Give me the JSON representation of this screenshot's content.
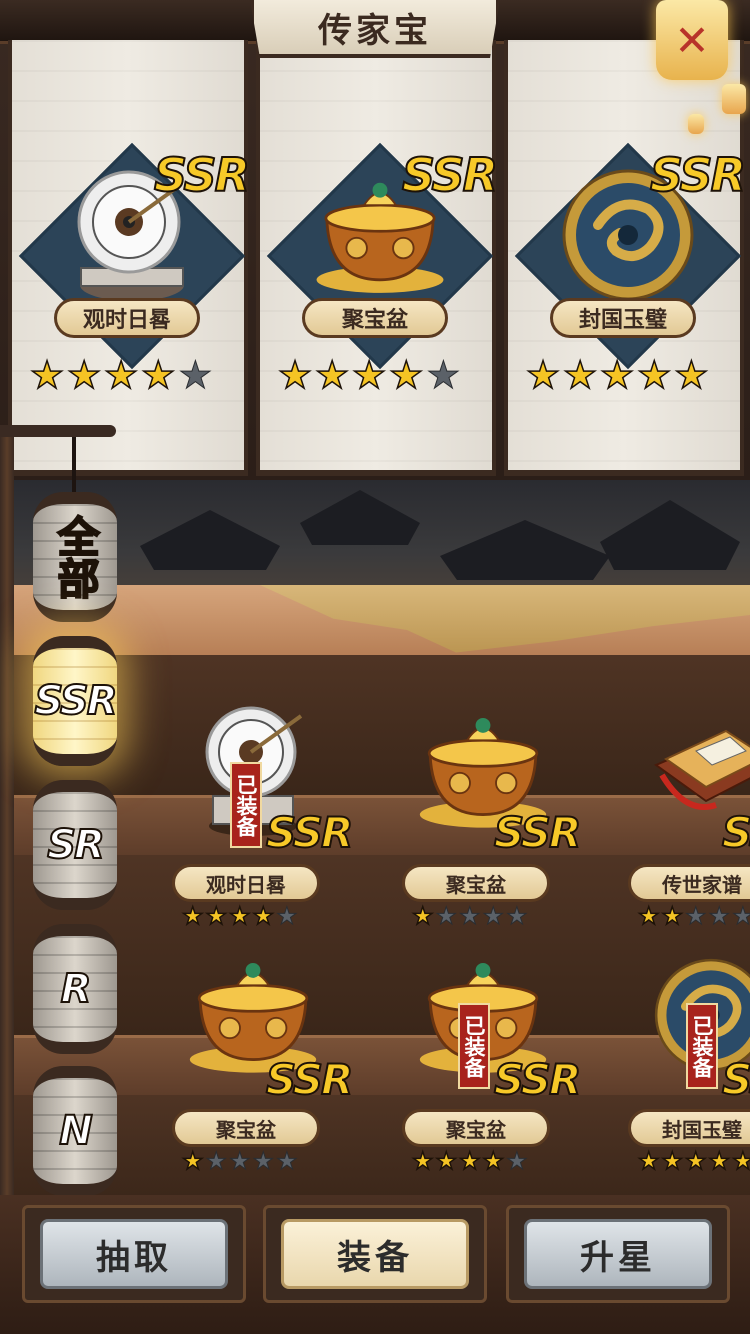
{
  "header": {
    "title": "传家宝",
    "close_icon": "close-lantern-icon"
  },
  "equipped": [
    {
      "name": "观时日晷",
      "rarity": "SSR",
      "stars_filled": 4,
      "stars_total": 5,
      "icon": "sundial-icon"
    },
    {
      "name": "聚宝盆",
      "rarity": "SSR",
      "stars_filled": 4,
      "stars_total": 5,
      "icon": "treasure-bowl-icon"
    },
    {
      "name": "封国玉璧",
      "rarity": "SSR",
      "stars_filled": 5,
      "stars_total": 5,
      "icon": "jade-disc-icon"
    }
  ],
  "tabs": [
    {
      "label": "全部",
      "active": false
    },
    {
      "label": "SSR",
      "active": true
    },
    {
      "label": "SR",
      "active": false
    },
    {
      "label": "R",
      "active": false
    },
    {
      "label": "N",
      "active": false
    }
  ],
  "inventory": [
    {
      "name": "观时日晷",
      "rarity": "SSR",
      "stars_filled": 4,
      "stars_total": 5,
      "equipped": true,
      "equipped_label": "已装备",
      "icon": "sundial-icon"
    },
    {
      "name": "聚宝盆",
      "rarity": "SSR",
      "stars_filled": 1,
      "stars_total": 5,
      "equipped": false,
      "equipped_label": "",
      "icon": "treasure-bowl-icon"
    },
    {
      "name": "传世家谱",
      "rarity": "SSR",
      "stars_filled": 2,
      "stars_total": 5,
      "equipped": false,
      "equipped_label": "",
      "icon": "family-book-icon"
    },
    {
      "name": "聚宝盆",
      "rarity": "SSR",
      "stars_filled": 1,
      "stars_total": 5,
      "equipped": false,
      "equipped_label": "",
      "icon": "treasure-bowl-icon"
    },
    {
      "name": "聚宝盆",
      "rarity": "SSR",
      "stars_filled": 4,
      "stars_total": 5,
      "equipped": true,
      "equipped_label": "已装备",
      "icon": "treasure-bowl-icon"
    },
    {
      "name": "封国玉璧",
      "rarity": "SSR",
      "stars_filled": 5,
      "stars_total": 5,
      "equipped": true,
      "equipped_label": "已装备",
      "icon": "jade-disc-icon"
    }
  ],
  "actions": [
    {
      "label": "抽取",
      "active": false
    },
    {
      "label": "装备",
      "active": true
    },
    {
      "label": "升星",
      "active": false
    }
  ],
  "colors": {
    "star_on": "#f5c424",
    "star_off": "#5b6168",
    "ssr_gold": "#f7c928",
    "equipped_red": "#a8231c",
    "scroll_paper": "#ece7de",
    "wood": "#5e3d2a"
  }
}
